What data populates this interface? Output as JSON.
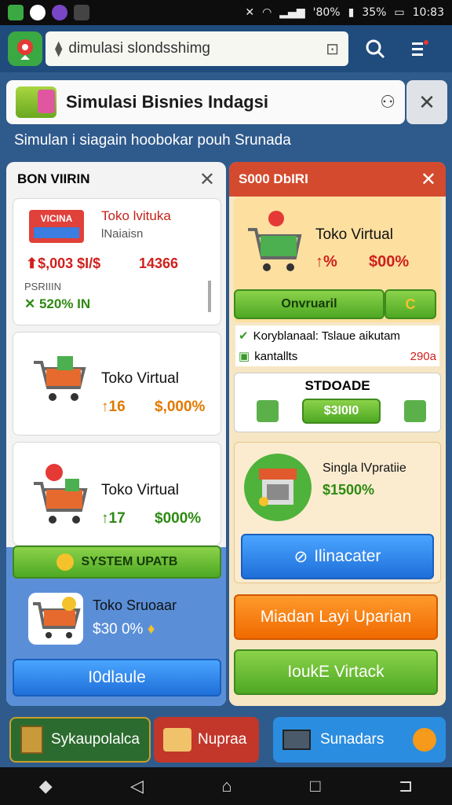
{
  "status": {
    "percent1": "'80%",
    "percent2": "35%",
    "time": "10:83"
  },
  "browser": {
    "url": "dimulasi slondsshimg"
  },
  "app": {
    "title": "Simulasi Bisnies Indagsi",
    "subtitle": "Simulan i siagain hoobokar pouh Srunada"
  },
  "left_panel": {
    "header": "BON VIIRIN",
    "card1": {
      "label_tag": "VICINA",
      "name": "Toko lvituka",
      "sub": "lNaiaisn",
      "price": "$,003 $I/$",
      "count": "14366",
      "section_label": "PSRIIIN",
      "stat": "520% IN"
    },
    "card2": {
      "name": "Toko Virtual",
      "a": "16",
      "b": "$,000%"
    },
    "card3": {
      "name": "Toko Virtual",
      "a": "17",
      "b": "$000%"
    },
    "system_button": "SYSTEM UPATB",
    "card4": {
      "name": "Toko Sruoaar",
      "price": "$30 0%"
    },
    "bottom_button": "I0dlaule"
  },
  "right_panel": {
    "header": "S000 DbIRI",
    "card1": {
      "name": "Toko Virtual",
      "a": "%",
      "b": "$00%"
    },
    "green_button": "Onvruaril",
    "green_button_badge": "C",
    "row1": "Koryblanaal: Tslaue aikutam",
    "row2": "kantallts",
    "row2_value": "290a",
    "storage": {
      "title": "STDOADE",
      "value": "$3I0I0"
    },
    "shop": {
      "name": "Singla lVpratiie",
      "price": "$1500%"
    },
    "blue_button": "Ilinacater",
    "orange_button": "Miadan Layi Uparian",
    "green_bottom_button": "IoukE Virtack"
  },
  "tabs": [
    {
      "label": "Sykaupolalca",
      "color": "#2c6b2f"
    },
    {
      "label": "Nupraa",
      "color": "#c2372a"
    },
    {
      "label": "Sunadars",
      "color": "#2b8de0"
    }
  ],
  "colors": {
    "accent_green": "#4ea823",
    "accent_red": "#d44a2e",
    "accent_blue": "#1f6fd9",
    "background": "#2f5a8c"
  }
}
